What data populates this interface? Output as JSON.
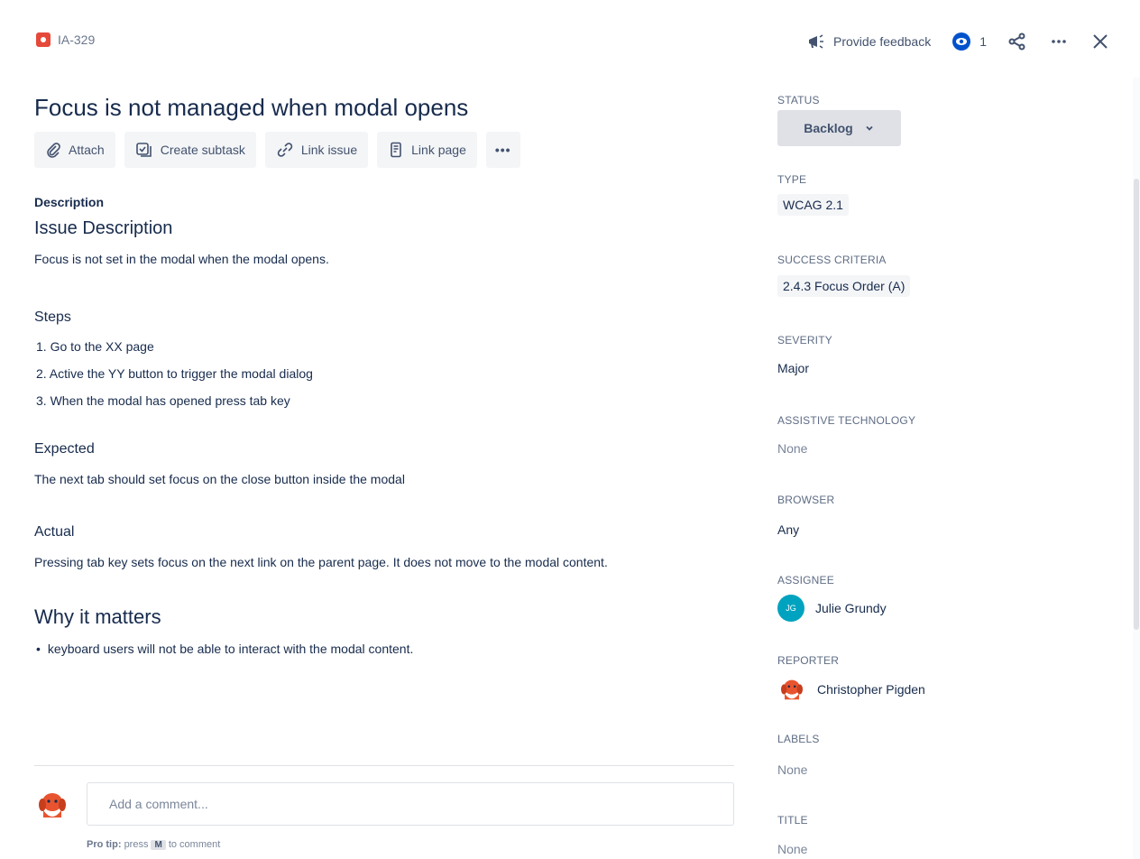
{
  "header": {
    "issue_key": "IA-329",
    "feedback_label": "Provide feedback",
    "watch_count": "1"
  },
  "main": {
    "title": "Focus is not managed when modal opens",
    "toolbar": {
      "attach": "Attach",
      "create_subtask": "Create subtask",
      "link_issue": "Link issue",
      "link_page": "Link page",
      "more": "•••"
    },
    "description_label": "Description",
    "issue_heading": "Issue Description",
    "issue_text": "Focus is not set in the modal when the modal opens.",
    "steps_heading": "Steps",
    "steps": [
      "1. Go to the XX page",
      "2. Active the YY button to trigger the modal dialog",
      "3. When the modal has opened press tab key"
    ],
    "expected_heading": "Expected",
    "expected_text": "The next tab should set focus on the close button inside the modal",
    "actual_heading": "Actual",
    "actual_text": "Pressing tab key sets focus on the next link on the parent page. It does not move to the modal content.",
    "why_heading": "Why it matters",
    "why_bullets": [
      "keyboard users will not be able to interact with the modal content."
    ]
  },
  "comment": {
    "placeholder": "Add a comment...",
    "tip_label": "Pro tip:",
    "tip_press": "press",
    "tip_key": "M",
    "tip_suffix": "to comment"
  },
  "sidebar": {
    "status_label": "STATUS",
    "status_value": "Backlog",
    "type_label": "TYPE",
    "type_value": "WCAG 2.1",
    "criteria_label": "SUCCESS CRITERIA",
    "criteria_value": "2.4.3 Focus Order (A)",
    "severity_label": "SEVERITY",
    "severity_value": "Major",
    "at_label": "ASSISTIVE TECHNOLOGY",
    "at_value": "None",
    "browser_label": "BROWSER",
    "browser_value": "Any",
    "assignee_label": "ASSIGNEE",
    "assignee_initials": "JG",
    "assignee_name": "Julie Grundy",
    "reporter_label": "REPORTER",
    "reporter_name": "Christopher Pigden",
    "labels_label": "LABELS",
    "labels_value": "None",
    "title_label": "TITLE",
    "title_value": "None"
  },
  "colors": {
    "bug": "#e5493a",
    "watch_icon": "#0052cc",
    "assignee_avatar": "#00a3bf",
    "reporter_avatar": "#e8542f"
  },
  "icons": [
    "bug-icon",
    "megaphone-icon",
    "eye-icon",
    "share-icon",
    "more-icon",
    "close-icon",
    "paperclip-icon",
    "subtask-icon",
    "link-icon",
    "page-icon",
    "chevron-down-icon"
  ]
}
